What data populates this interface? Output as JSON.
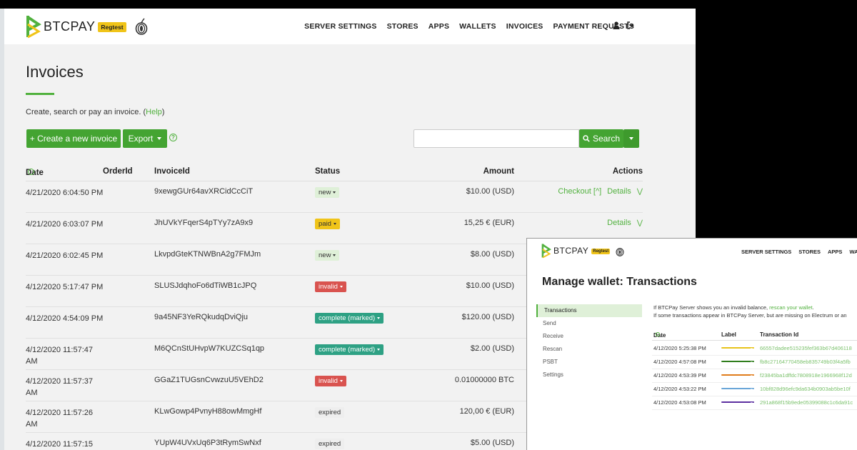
{
  "nav": {
    "brand": "BTCPAY",
    "badge": "Regtest",
    "links": [
      "SERVER SETTINGS",
      "STORES",
      "APPS",
      "WALLETS",
      "INVOICES",
      "PAYMENT REQUESTS"
    ]
  },
  "page": {
    "title": "Invoices",
    "intro_prefix": "Create, search or pay an invoice. (",
    "intro_link": "Help",
    "intro_suffix": ")"
  },
  "toolbar": {
    "create_label": "+ Create a new invoice",
    "export_label": "Export",
    "search_value": "",
    "search_label": "Search"
  },
  "table": {
    "headers": {
      "date": "Date",
      "order": "OrderId",
      "invoice": "InvoiceId",
      "status": "Status",
      "amount": "Amount",
      "actions": "Actions"
    },
    "rows": [
      {
        "date": "4/21/2020 6:04:50 PM",
        "invoice_id": "9xewgGUr64avXRCidCcCiT",
        "status": "new",
        "amount": "$10.00 (USD)",
        "checkout": "Checkout [^]",
        "details": "Details"
      },
      {
        "date": "4/21/2020 6:03:07 PM",
        "invoice_id": "JhUVkYFqerS4pTYy7zA9x9",
        "status": "paid",
        "amount": "15,25 € (EUR)",
        "checkout": "",
        "details": "Details"
      },
      {
        "date": "4/21/2020 6:02:45 PM",
        "invoice_id": "LkvpdGteKTNWBnA2g7FMJm",
        "status": "new",
        "amount": "$8.00 (USD)",
        "checkout": "",
        "details": ""
      },
      {
        "date": "4/12/2020 5:17:47 PM",
        "invoice_id": "SLUSJdqhoFo6dTiWB1cJPQ",
        "status": "invalid",
        "amount": "$10.00 (USD)",
        "checkout": "",
        "details": ""
      },
      {
        "date": "4/12/2020 4:54:09 PM",
        "invoice_id": "9a45NF3YeRQkudqDviQju",
        "status": "complete (marked)",
        "amount": "$120.00 (USD)",
        "checkout": "",
        "details": ""
      },
      {
        "date": "4/12/2020 11:57:47 AM",
        "invoice_id": "M6QCnStUHvpW7KUZCSq1qp",
        "status": "complete (marked)",
        "amount": "$2.00 (USD)",
        "checkout": "",
        "details": ""
      },
      {
        "date": "4/12/2020 11:57:37 AM",
        "invoice_id": "GGaZ1TUGsnCvwzuU5VEhD2",
        "status": "invalid",
        "amount": "0.01000000 BTC",
        "checkout": "",
        "details": ""
      },
      {
        "date": "4/12/2020 11:57:26 AM",
        "invoice_id": "KLwGowp4PvnyH88owMmgHf",
        "status": "expired",
        "amount": "120,00 € (EUR)",
        "checkout": "",
        "details": ""
      },
      {
        "date": "4/12/2020 11:57:15",
        "invoice_id": "YUpW4UVxUq6P3tRymSwNxf",
        "status": "expired",
        "amount": "$5.00 (USD)",
        "checkout": "",
        "details": ""
      }
    ]
  },
  "wallet": {
    "nav_links": [
      "SERVER SETTINGS",
      "STORES",
      "APPS",
      "WALLET"
    ],
    "title": "Manage wallet: Transactions",
    "sidebar": [
      "Transactions",
      "Send",
      "Receive",
      "Rescan",
      "PSBT",
      "Settings"
    ],
    "info_line1_prefix": "If BTCPay Server shows you an invalid balance, ",
    "info_line1_link": "rescan your wallet",
    "info_line1_suffix": ".",
    "info_line2": "If some transactions appear in BTCPay Server, but are missing on Electrum or an",
    "headers": {
      "date": "Date",
      "label": "Label",
      "txid": "Transaction Id"
    },
    "rows": [
      {
        "date": "4/12/2020 5:25:38 PM",
        "label": "exchange",
        "txid": "66557dadee515235fef363b67d406118"
      },
      {
        "date": "4/12/2020 4:57:08 PM",
        "label": "merchant 1",
        "txid": "fb8c27164770458eb835749b03f4a5fb"
      },
      {
        "date": "4/12/2020 4:53:39 PM",
        "label": "joe",
        "txid": "f23845ba1dffdc7808918e1966968f12d"
      },
      {
        "date": "4/12/2020 4:53:22 PM",
        "label": "caren",
        "txid": "10bf828d96efc9da634b0903ab5be10f"
      },
      {
        "date": "4/12/2020 4:53:08 PM",
        "label": "merchant 2",
        "txid": "291a868f15b9ede05399088c1c6da91c"
      }
    ]
  },
  "colors": {
    "accent": "#51b13e",
    "new": "#dff0d8",
    "paid": "#f0c419",
    "invalid": "#d9534f",
    "complete": "#2ea184",
    "label_exchange": "#e8c31a",
    "label_merchant1": "#2f7d1c",
    "label_joe": "#e07b1b",
    "label_caren": "#6aa6d8",
    "label_merchant2": "#5c2fa0"
  }
}
